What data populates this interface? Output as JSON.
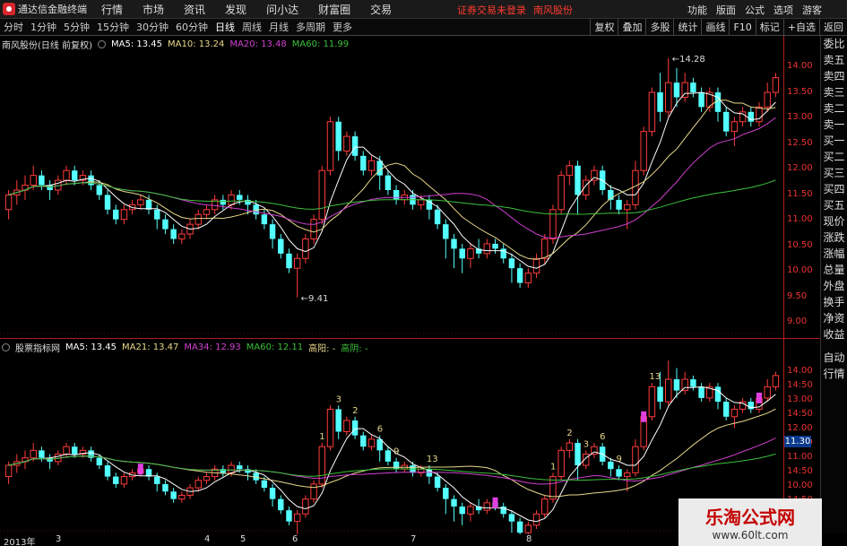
{
  "app": {
    "title": "通达信金融终端",
    "menus": [
      "行情",
      "市场",
      "资讯",
      "发现",
      "问小达",
      "财富圈",
      "交易"
    ],
    "status": [
      "证券交易未登录",
      "南风股份"
    ],
    "right_menus": [
      "功能",
      "版面",
      "公式",
      "选项",
      "游客"
    ]
  },
  "periodbar": {
    "periods": [
      "分时",
      "1分钟",
      "5分钟",
      "15分钟",
      "30分钟",
      "60分钟",
      "日线",
      "周线",
      "月线",
      "多周期",
      "更多"
    ],
    "active": "日线",
    "tools": [
      "复权",
      "叠加",
      "多股",
      "统计",
      "画线",
      "F10",
      "标记",
      "+自选",
      "返回"
    ]
  },
  "main_panel": {
    "stock_label": "南风股份(日线 前复权)",
    "indicators": [
      {
        "label": "MA5: 13.45",
        "color": "#ffffff"
      },
      {
        "label": "MA10: 13.24",
        "color": "#e8d88a"
      },
      {
        "label": "MA20: 13.48",
        "color": "#d040d0"
      },
      {
        "label": "MA60: 11.99",
        "color": "#3cc03c"
      }
    ],
    "annotations": {
      "high": "14.28",
      "low": "9.41"
    }
  },
  "indicator_panel": {
    "name": "股票指标网",
    "indicators": [
      {
        "label": "MA5: 13.45",
        "color": "#ffffff"
      },
      {
        "label": "MA21: 13.47",
        "color": "#e8d88a"
      },
      {
        "label": "MA34: 12.93",
        "color": "#d040d0"
      },
      {
        "label": "MA60: 12.11",
        "color": "#3cc03c"
      },
      {
        "label": "高阳: -",
        "color": "#e8d88a"
      },
      {
        "label": "高阴: -",
        "color": "#3cc03c"
      }
    ],
    "signal_numbers": [
      "1",
      "3",
      "2",
      "6",
      "9",
      "13",
      "1",
      "2",
      "3",
      "6",
      "9",
      "13"
    ],
    "current_price": "11.30"
  },
  "main_axis": [
    "14.00",
    "13.50",
    "13.00",
    "12.50",
    "12.00",
    "11.50",
    "11.00",
    "10.50",
    "10.00",
    "9.50",
    "9.00"
  ],
  "ind_axis": [
    "14.00",
    "14:50",
    "13.00",
    "14:50",
    "12.00",
    "14:50",
    "11.00",
    "14:50",
    "10.00",
    "14:50"
  ],
  "xaxis": [
    "2013年",
    "3",
    "4",
    "5",
    "6",
    "7",
    "8"
  ],
  "sidetabs": [
    "委比",
    "卖五",
    "卖四",
    "卖三",
    "卖二",
    "卖一",
    "买一",
    "买二",
    "买三",
    "买四",
    "买五",
    "现价",
    "涨跌",
    "涨幅",
    "总量",
    "外盘",
    "换手",
    "净资",
    "收益",
    "自动",
    "行情"
  ],
  "watermark": {
    "title": "乐淘公式网",
    "url": "www.60lt.com"
  },
  "chart_data": {
    "type": "candlestick",
    "title": "南风股份(日线 前复权)",
    "ylim": [
      8.7,
      14.5
    ],
    "up_color": "#ff3b3b",
    "down_color": "#54ffff",
    "candles": [
      [
        11.2,
        11.5,
        11.0,
        11.6
      ],
      [
        11.5,
        11.6,
        11.3,
        11.8
      ],
      [
        11.6,
        11.7,
        11.4,
        11.9
      ],
      [
        11.7,
        11.9,
        11.6,
        12.1
      ],
      [
        11.9,
        11.7,
        11.6,
        12.0
      ],
      [
        11.7,
        11.6,
        11.4,
        11.8
      ],
      [
        11.6,
        11.8,
        11.5,
        11.9
      ],
      [
        11.8,
        12.0,
        11.7,
        12.1
      ],
      [
        12.0,
        11.8,
        11.7,
        12.1
      ],
      [
        11.8,
        11.9,
        11.7,
        12.0
      ],
      [
        11.9,
        11.7,
        11.6,
        12.0
      ],
      [
        11.7,
        11.5,
        11.4,
        11.8
      ],
      [
        11.5,
        11.2,
        11.1,
        11.6
      ],
      [
        11.2,
        11.0,
        10.9,
        11.3
      ],
      [
        11.0,
        11.2,
        10.9,
        11.3
      ],
      [
        11.2,
        11.3,
        11.1,
        11.4
      ],
      [
        11.3,
        11.4,
        11.2,
        11.5
      ],
      [
        11.4,
        11.2,
        11.1,
        11.5
      ],
      [
        11.2,
        11.0,
        10.8,
        11.3
      ],
      [
        11.0,
        10.8,
        10.7,
        11.1
      ],
      [
        10.8,
        10.6,
        10.5,
        10.9
      ],
      [
        10.6,
        10.7,
        10.5,
        10.8
      ],
      [
        10.7,
        10.9,
        10.6,
        11.0
      ],
      [
        10.9,
        11.1,
        10.8,
        11.2
      ],
      [
        11.1,
        11.2,
        11.0,
        11.3
      ],
      [
        11.2,
        11.4,
        11.1,
        11.5
      ],
      [
        11.4,
        11.3,
        11.2,
        11.5
      ],
      [
        11.3,
        11.5,
        11.2,
        11.6
      ],
      [
        11.5,
        11.4,
        11.3,
        11.6
      ],
      [
        11.4,
        11.3,
        11.1,
        11.5
      ],
      [
        11.3,
        11.1,
        11.0,
        11.4
      ],
      [
        11.1,
        10.9,
        10.8,
        11.2
      ],
      [
        10.9,
        10.6,
        10.4,
        11.0
      ],
      [
        10.6,
        10.3,
        10.2,
        10.7
      ],
      [
        10.3,
        10.0,
        9.9,
        10.4
      ],
      [
        10.0,
        10.2,
        9.4,
        10.3
      ],
      [
        10.2,
        10.6,
        10.1,
        10.7
      ],
      [
        10.6,
        11.0,
        10.5,
        11.1
      ],
      [
        11.0,
        12.0,
        10.9,
        12.1
      ],
      [
        12.0,
        13.0,
        11.9,
        13.1
      ],
      [
        13.0,
        12.4,
        12.2,
        13.1
      ],
      [
        12.4,
        12.7,
        12.3,
        12.8
      ],
      [
        12.7,
        12.3,
        12.2,
        12.8
      ],
      [
        12.3,
        12.0,
        11.9,
        12.4
      ],
      [
        12.0,
        12.2,
        11.9,
        12.3
      ],
      [
        12.2,
        11.9,
        11.6,
        12.3
      ],
      [
        11.9,
        11.6,
        11.5,
        12.0
      ],
      [
        11.6,
        11.4,
        11.3,
        11.7
      ],
      [
        11.4,
        11.5,
        11.3,
        11.6
      ],
      [
        11.5,
        11.3,
        11.2,
        11.6
      ],
      [
        11.3,
        11.4,
        11.2,
        11.5
      ],
      [
        11.4,
        11.2,
        11.0,
        11.5
      ],
      [
        11.2,
        10.9,
        10.8,
        11.3
      ],
      [
        10.9,
        10.6,
        10.2,
        11.0
      ],
      [
        10.6,
        10.4,
        10.0,
        10.7
      ],
      [
        10.4,
        10.2,
        9.9,
        10.5
      ],
      [
        10.2,
        10.4,
        10.0,
        10.5
      ],
      [
        10.4,
        10.3,
        10.2,
        10.6
      ],
      [
        10.3,
        10.5,
        10.2,
        10.6
      ],
      [
        10.5,
        10.4,
        10.3,
        10.6
      ],
      [
        10.4,
        10.2,
        10.1,
        10.5
      ],
      [
        10.2,
        10.0,
        9.7,
        10.3
      ],
      [
        10.0,
        9.7,
        9.6,
        10.1
      ],
      [
        9.7,
        9.9,
        9.6,
        10.0
      ],
      [
        9.9,
        10.2,
        9.8,
        10.3
      ],
      [
        10.2,
        10.6,
        10.1,
        10.7
      ],
      [
        10.6,
        11.2,
        10.5,
        11.3
      ],
      [
        11.2,
        11.9,
        11.1,
        12.0
      ],
      [
        11.9,
        12.1,
        11.7,
        12.2
      ],
      [
        12.1,
        11.5,
        11.1,
        12.2
      ],
      [
        11.5,
        11.8,
        11.4,
        11.9
      ],
      [
        11.8,
        12.0,
        11.7,
        12.1
      ],
      [
        12.0,
        11.6,
        11.5,
        12.1
      ],
      [
        11.6,
        11.4,
        11.2,
        11.7
      ],
      [
        11.4,
        11.2,
        11.1,
        11.5
      ],
      [
        11.2,
        11.3,
        10.8,
        11.4
      ],
      [
        11.3,
        12.0,
        11.2,
        12.2
      ],
      [
        12.0,
        12.8,
        11.9,
        12.9
      ],
      [
        12.8,
        13.6,
        12.7,
        13.7
      ],
      [
        13.6,
        13.2,
        13.0,
        14.0
      ],
      [
        13.2,
        13.8,
        13.1,
        14.3
      ],
      [
        13.8,
        13.5,
        13.3,
        14.1
      ],
      [
        13.5,
        13.8,
        13.4,
        14.0
      ],
      [
        13.8,
        13.6,
        13.5,
        13.9
      ],
      [
        13.6,
        13.3,
        13.2,
        13.7
      ],
      [
        13.3,
        13.6,
        13.2,
        13.7
      ],
      [
        13.6,
        13.2,
        13.0,
        13.7
      ],
      [
        13.2,
        12.8,
        12.7,
        13.3
      ],
      [
        12.8,
        13.0,
        12.5,
        13.1
      ],
      [
        13.0,
        13.2,
        12.9,
        13.3
      ],
      [
        13.2,
        13.0,
        12.9,
        13.3
      ],
      [
        13.0,
        13.3,
        12.9,
        13.4
      ],
      [
        13.3,
        13.6,
        13.2,
        13.8
      ],
      [
        13.6,
        13.9,
        13.5,
        14.0
      ]
    ],
    "moving_averages": [
      {
        "name": "MA5",
        "color": "#ffffff",
        "period": 5
      },
      {
        "name": "MA10",
        "color": "#e8d88a",
        "period": 10
      },
      {
        "name": "MA20",
        "color": "#d040d0",
        "period": 20
      },
      {
        "name": "MA60",
        "color": "#3cc03c",
        "period": 60
      }
    ]
  }
}
